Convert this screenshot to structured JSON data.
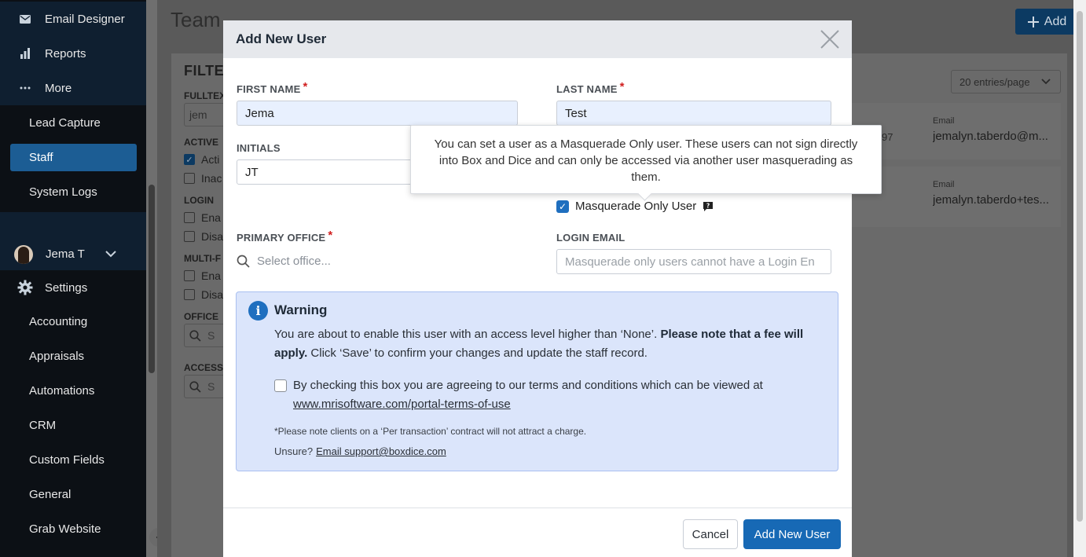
{
  "sidebar": {
    "items_top": [
      {
        "label": "Email Designer",
        "icon": "mail-icon"
      },
      {
        "label": "Reports",
        "icon": "bar-chart-icon"
      },
      {
        "label": "More",
        "icon": "more-icon"
      }
    ],
    "sub_items": [
      "Lead Capture",
      "Staff",
      "System Logs"
    ],
    "active_item": "Staff",
    "user_name": "Jema T",
    "settings_label": "Settings",
    "settings_items": [
      "Accounting",
      "Appraisals",
      "Automations",
      "CRM",
      "Custom Fields",
      "General",
      "Grab Website"
    ]
  },
  "main": {
    "title": "Team",
    "add_label": "Add",
    "filter_title": "FILTE",
    "filter_labels": [
      "FULLTEX",
      "ACTIVE",
      "LOGIN",
      "MULTI-F",
      "OFFICE",
      "ACCESS"
    ],
    "fulltext_value": "jem",
    "active_options": [
      "Acti",
      "Inac"
    ],
    "login_options": [
      "Ena",
      "Disa"
    ],
    "multi_options": [
      "Ena",
      "Disa"
    ],
    "search_stub": "S",
    "entries_label": "20 entries/page",
    "row_fragment": "97",
    "results": [
      {
        "key": "Email",
        "value": "jemalyn.taberdo@m..."
      },
      {
        "key": "Email",
        "value": "jemalyn.taberdo+tes..."
      }
    ]
  },
  "modal": {
    "title": "Add New User",
    "first_name_label": "FIRST NAME",
    "first_name_value": "Jema",
    "last_name_label": "LAST NAME",
    "last_name_value": "Test",
    "initials_label": "INITIALS",
    "initials_value": "JT",
    "masquerade_label": "Masquerade Only User",
    "primary_office_label": "PRIMARY OFFICE",
    "office_placeholder": "Select office...",
    "login_email_label": "LOGIN EMAIL",
    "login_email_placeholder": "Masquerade only users cannot have a Login En",
    "required_mark": "*",
    "warning": {
      "title": "Warning",
      "body_1": "You are about to enable this user with an access level higher than ‘None’.",
      "body_bold": "Please note that a fee will apply.",
      "body_2": "Click ‘Save’ to confirm your changes and update the staff record.",
      "terms_text": "By checking this box you are agreeing to our terms and conditions which can be viewed at",
      "terms_link": "www.mrisoftware.com/portal-terms-of-use",
      "note": "*Please note clients on a ‘Per transaction’ contract will not attract a charge.",
      "unsure_label": "Unsure?",
      "unsure_link": "Email support@boxdice.com"
    },
    "cancel_label": "Cancel",
    "submit_label": "Add New User"
  },
  "tooltip": {
    "text": "You can set a user as a Masquerade Only user. These users can not sign directly into Box and Dice and can only be accessed via another user masquerading as them."
  },
  "colors": {
    "sidebar_bg": "#0c1015",
    "active_item": "#1c5d94",
    "primary_button": "#1769b5",
    "warning_bg": "#dbe5fb",
    "required": "#d12020"
  }
}
